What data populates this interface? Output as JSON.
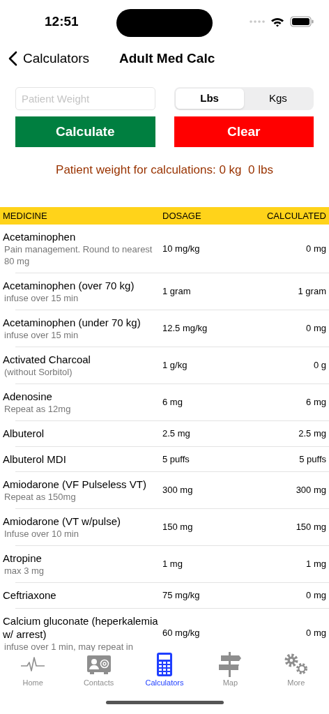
{
  "status_bar": {
    "time": "12:51"
  },
  "nav": {
    "back": "Calculators",
    "title": "Adult Med Calc"
  },
  "weight_field": {
    "placeholder": "Patient Weight"
  },
  "units": [
    {
      "label": "Lbs",
      "selected": true
    },
    {
      "label": "Kgs",
      "selected": false
    }
  ],
  "buttons": [
    {
      "label": "Calculate",
      "kind": "calculate"
    },
    {
      "label": "Clear",
      "kind": "clear"
    }
  ],
  "weight_summary": "Patient weight for calculations: 0 kg  0 lbs",
  "table": {
    "columns": [
      "MEDICINE",
      "DOSAGE",
      "CALCULATED"
    ],
    "rows": [
      {
        "medicine": "Acetaminophen",
        "note": "Pain management. Round to nearest 80 mg",
        "dosage": "10 mg/kg",
        "calculated": "0 mg"
      },
      {
        "medicine": "Acetaminophen (over 70 kg)",
        "note": "infuse over 15 min",
        "dosage": "1 gram",
        "calculated": "1 gram"
      },
      {
        "medicine": "Acetaminophen (under 70 kg)",
        "note": "infuse over 15 min",
        "dosage": "12.5 mg/kg",
        "calculated": "0 mg"
      },
      {
        "medicine": "Activated Charcoal",
        "note": "(without Sorbitol)",
        "dosage": "1 g/kg",
        "calculated": "0 g"
      },
      {
        "medicine": "Adenosine",
        "note": "Repeat as 12mg",
        "dosage": "6 mg",
        "calculated": "6 mg"
      },
      {
        "medicine": "Albuterol",
        "dosage": "2.5 mg",
        "calculated": "2.5 mg"
      },
      {
        "medicine": "Albuterol MDI",
        "dosage": "5 puffs",
        "calculated": "5 puffs"
      },
      {
        "medicine": "Amiodarone (VF Pulseless VT)",
        "note": "Repeat as 150mg",
        "dosage": "300 mg",
        "calculated": "300 mg"
      },
      {
        "medicine": "Amiodarone (VT w/pulse)",
        "note": "Infuse over 10 min",
        "dosage": "150 mg",
        "calculated": "150 mg"
      },
      {
        "medicine": "Atropine",
        "note": "max 3 mg",
        "dosage": "1 mg",
        "calculated": "1 mg"
      },
      {
        "medicine": "Ceftriaxone",
        "dosage": "75 mg/kg",
        "calculated": "0 mg"
      },
      {
        "medicine": "Calcium gluconate (heperkalemia w/ arrest)",
        "note": "infuse over 1 min, may repeat in",
        "dosage": "60 mg/kg",
        "calculated": "0 mg"
      }
    ]
  },
  "tab_bar": [
    {
      "label": "Home",
      "kind": "heartbeat",
      "selected": false
    },
    {
      "label": "Contacts",
      "kind": "contacts",
      "selected": false
    },
    {
      "label": "Calculators",
      "kind": "calculator",
      "selected": true
    },
    {
      "label": "Map",
      "kind": "signpost",
      "selected": false
    },
    {
      "label": "More",
      "kind": "gears",
      "selected": false
    }
  ]
}
